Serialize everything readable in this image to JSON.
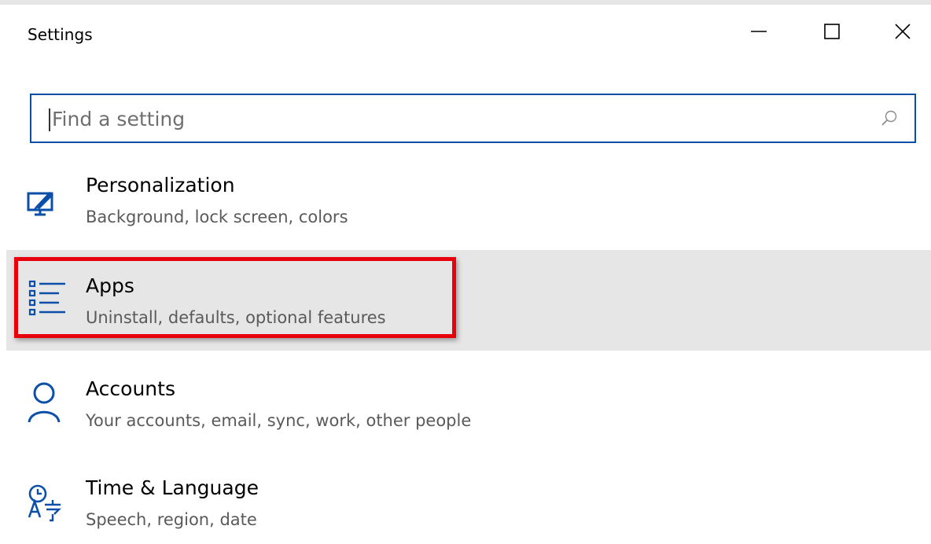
{
  "window": {
    "title": "Settings",
    "controls": {
      "minimize": "minimize-icon",
      "maximize": "maximize-icon",
      "close": "close-icon"
    }
  },
  "search": {
    "placeholder": "Find a setting",
    "icon": "search-icon"
  },
  "items": [
    {
      "label": "Personalization",
      "desc": "Background, lock screen, colors",
      "icon": "personalization-icon"
    },
    {
      "label": "Apps",
      "desc": "Uninstall, defaults, optional features",
      "icon": "apps-list-icon",
      "highlighted": true
    },
    {
      "label": "Accounts",
      "desc": "Your accounts, email, sync, work, other people",
      "icon": "person-icon"
    },
    {
      "label": "Time & Language",
      "desc": "Speech, region, date",
      "icon": "time-language-icon"
    }
  ],
  "colors": {
    "accent": "#0b4fa8",
    "highlight_box": "#e8000a",
    "selected_bg": "#e6e6e6"
  }
}
